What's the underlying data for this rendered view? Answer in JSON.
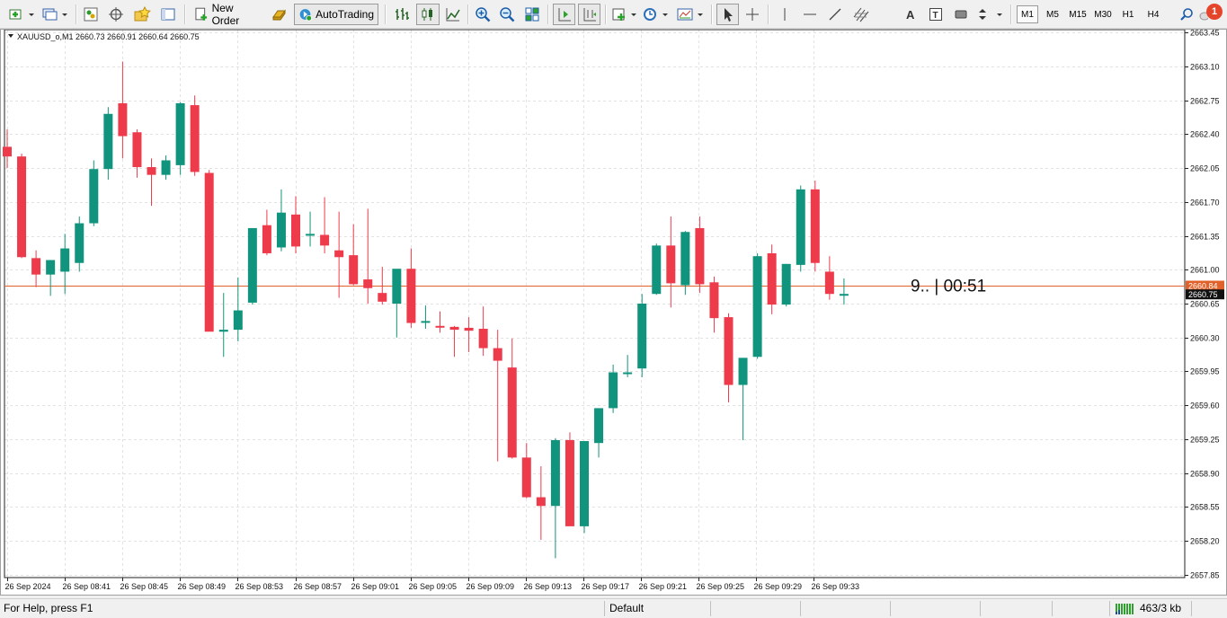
{
  "toolbar": {
    "new_order_label": "New Order",
    "autotrading_label": "AutoTrading",
    "timeframes": [
      "M1",
      "M5",
      "M15",
      "M30",
      "H1",
      "H4"
    ],
    "active_timeframe": "M1",
    "notification_count": "1"
  },
  "chart": {
    "header": "XAUUSD_o,M1  2660.73 2660.91 2660.64 2660.75",
    "countdown": "9.. | 00:51",
    "bid_price_label": "2660.84",
    "last_price_label": "2660.75",
    "colors": {
      "bull": "#11947d",
      "bear": "#ee3b4c",
      "price_line": "#e0622a",
      "grid": "#e2e2e2"
    }
  },
  "chart_data": {
    "type": "candlestick",
    "symbol": "XAUUSD_o",
    "timeframe": "M1",
    "y_ticks": [
      "2663.45",
      "2663.10",
      "2662.75",
      "2662.40",
      "2662.05",
      "2661.70",
      "2661.35",
      "2661.00",
      "2660.65",
      "2660.30",
      "2659.95",
      "2659.60",
      "2659.25",
      "2658.90",
      "2658.55",
      "2658.20",
      "2657.85"
    ],
    "ylim": [
      2657.82,
      2663.48
    ],
    "x_ticks": [
      "26 Sep 2024",
      "26 Sep 08:41",
      "26 Sep 08:45",
      "26 Sep 08:49",
      "26 Sep 08:53",
      "26 Sep 08:57",
      "26 Sep 09:01",
      "26 Sep 09:05",
      "26 Sep 09:09",
      "26 Sep 09:13",
      "26 Sep 09:17",
      "26 Sep 09:21",
      "26 Sep 09:25",
      "26 Sep 09:29",
      "26 Sep 09:33"
    ],
    "candles": [
      {
        "o": 2662.27,
        "h": 2662.45,
        "l": 2662.05,
        "c": 2662.17
      },
      {
        "o": 2662.17,
        "h": 2662.2,
        "l": 2661.12,
        "c": 2661.13
      },
      {
        "o": 2661.12,
        "h": 2661.2,
        "l": 2660.82,
        "c": 2660.95
      },
      {
        "o": 2660.95,
        "h": 2661.08,
        "l": 2660.73,
        "c": 2661.1
      },
      {
        "o": 2660.98,
        "h": 2661.37,
        "l": 2660.75,
        "c": 2661.22
      },
      {
        "o": 2661.07,
        "h": 2661.55,
        "l": 2660.98,
        "c": 2661.48
      },
      {
        "o": 2661.48,
        "h": 2662.13,
        "l": 2661.45,
        "c": 2662.04
      },
      {
        "o": 2662.04,
        "h": 2662.68,
        "l": 2661.93,
        "c": 2662.61
      },
      {
        "o": 2662.72,
        "h": 2663.15,
        "l": 2662.15,
        "c": 2662.38
      },
      {
        "o": 2662.42,
        "h": 2662.45,
        "l": 2661.95,
        "c": 2662.06
      },
      {
        "o": 2662.06,
        "h": 2662.15,
        "l": 2661.66,
        "c": 2661.98
      },
      {
        "o": 2661.98,
        "h": 2662.18,
        "l": 2661.93,
        "c": 2662.13
      },
      {
        "o": 2662.08,
        "h": 2662.73,
        "l": 2661.98,
        "c": 2662.72
      },
      {
        "o": 2662.7,
        "h": 2662.8,
        "l": 2661.97,
        "c": 2662.01
      },
      {
        "o": 2662.0,
        "h": 2662.03,
        "l": 2660.39,
        "c": 2660.36
      },
      {
        "o": 2660.36,
        "h": 2660.76,
        "l": 2660.1,
        "c": 2660.38
      },
      {
        "o": 2660.38,
        "h": 2660.92,
        "l": 2660.26,
        "c": 2660.58
      },
      {
        "o": 2660.66,
        "h": 2661.42,
        "l": 2660.64,
        "c": 2661.43
      },
      {
        "o": 2661.46,
        "h": 2661.62,
        "l": 2661.15,
        "c": 2661.17
      },
      {
        "o": 2661.23,
        "h": 2661.83,
        "l": 2661.19,
        "c": 2661.59
      },
      {
        "o": 2661.57,
        "h": 2661.76,
        "l": 2661.17,
        "c": 2661.24
      },
      {
        "o": 2661.36,
        "h": 2661.6,
        "l": 2661.24,
        "c": 2661.37
      },
      {
        "o": 2661.36,
        "h": 2661.75,
        "l": 2661.17,
        "c": 2661.25
      },
      {
        "o": 2661.2,
        "h": 2661.6,
        "l": 2660.71,
        "c": 2661.13
      },
      {
        "o": 2661.15,
        "h": 2661.47,
        "l": 2660.84,
        "c": 2660.85
      },
      {
        "o": 2660.9,
        "h": 2661.63,
        "l": 2660.65,
        "c": 2660.81
      },
      {
        "o": 2660.76,
        "h": 2661.03,
        "l": 2660.64,
        "c": 2660.67
      },
      {
        "o": 2660.65,
        "h": 2661.0,
        "l": 2660.3,
        "c": 2661.01
      },
      {
        "o": 2661.01,
        "h": 2661.22,
        "l": 2660.4,
        "c": 2660.45
      },
      {
        "o": 2660.47,
        "h": 2660.63,
        "l": 2660.39,
        "c": 2660.47
      },
      {
        "o": 2660.42,
        "h": 2660.57,
        "l": 2660.35,
        "c": 2660.41
      },
      {
        "o": 2660.41,
        "h": 2660.42,
        "l": 2660.1,
        "c": 2660.38
      },
      {
        "o": 2660.4,
        "h": 2660.51,
        "l": 2660.15,
        "c": 2660.37
      },
      {
        "o": 2660.39,
        "h": 2660.62,
        "l": 2660.11,
        "c": 2660.19
      },
      {
        "o": 2660.19,
        "h": 2660.38,
        "l": 2659.02,
        "c": 2660.06
      },
      {
        "o": 2659.99,
        "h": 2660.29,
        "l": 2659.05,
        "c": 2659.06
      },
      {
        "o": 2659.06,
        "h": 2659.21,
        "l": 2658.64,
        "c": 2658.65
      },
      {
        "o": 2658.65,
        "h": 2658.97,
        "l": 2658.21,
        "c": 2658.56
      },
      {
        "o": 2658.56,
        "h": 2659.26,
        "l": 2658.02,
        "c": 2659.24
      },
      {
        "o": 2659.24,
        "h": 2659.32,
        "l": 2658.38,
        "c": 2658.35
      },
      {
        "o": 2658.35,
        "h": 2659.23,
        "l": 2658.28,
        "c": 2659.23
      },
      {
        "o": 2659.21,
        "h": 2659.56,
        "l": 2659.06,
        "c": 2659.57
      },
      {
        "o": 2659.57,
        "h": 2660.02,
        "l": 2659.52,
        "c": 2659.94
      },
      {
        "o": 2659.93,
        "h": 2660.12,
        "l": 2659.89,
        "c": 2659.94
      },
      {
        "o": 2659.98,
        "h": 2660.75,
        "l": 2659.89,
        "c": 2660.65
      },
      {
        "o": 2660.75,
        "h": 2661.27,
        "l": 2660.74,
        "c": 2661.25
      },
      {
        "o": 2661.25,
        "h": 2661.55,
        "l": 2660.61,
        "c": 2660.86
      },
      {
        "o": 2660.84,
        "h": 2661.4,
        "l": 2660.74,
        "c": 2661.39
      },
      {
        "o": 2661.43,
        "h": 2661.55,
        "l": 2660.76,
        "c": 2660.85
      },
      {
        "o": 2660.87,
        "h": 2660.93,
        "l": 2660.35,
        "c": 2660.5
      },
      {
        "o": 2660.51,
        "h": 2660.55,
        "l": 2659.63,
        "c": 2659.81
      },
      {
        "o": 2659.81,
        "h": 2660.08,
        "l": 2659.24,
        "c": 2660.09
      },
      {
        "o": 2660.1,
        "h": 2661.17,
        "l": 2660.08,
        "c": 2661.14
      },
      {
        "o": 2661.17,
        "h": 2661.26,
        "l": 2660.54,
        "c": 2660.64
      },
      {
        "o": 2660.64,
        "h": 2661.06,
        "l": 2660.62,
        "c": 2661.06
      },
      {
        "o": 2661.05,
        "h": 2661.87,
        "l": 2660.98,
        "c": 2661.83
      },
      {
        "o": 2661.83,
        "h": 2661.92,
        "l": 2660.98,
        "c": 2661.07
      },
      {
        "o": 2660.98,
        "h": 2661.14,
        "l": 2660.69,
        "c": 2660.75
      },
      {
        "o": 2660.75,
        "h": 2660.91,
        "l": 2660.64,
        "c": 2660.75
      }
    ]
  },
  "status": {
    "help": "For Help, press F1",
    "profile": "Default",
    "traffic": "463/3 kb"
  }
}
